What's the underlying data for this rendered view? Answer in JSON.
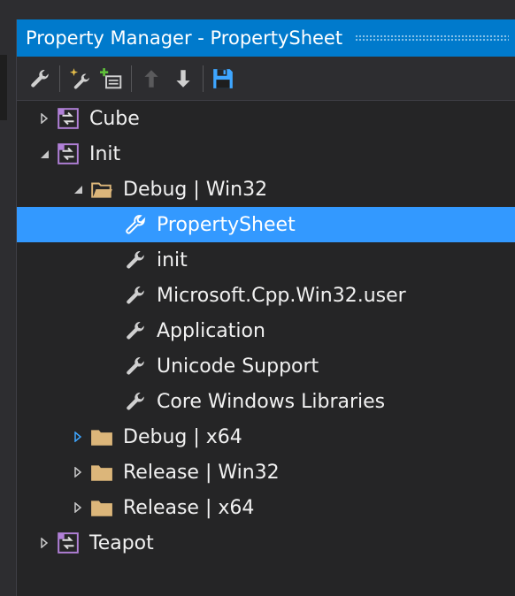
{
  "window": {
    "title": "Property Manager - PropertySheet"
  },
  "toolbar": {
    "buttons": [
      {
        "icon": "wrench-icon",
        "label": "Properties"
      },
      {
        "icon": "new-property-sheet-icon",
        "label": "Add New Project Property Sheet"
      },
      {
        "icon": "add-existing-sheet-icon",
        "label": "Add Existing Property Sheet"
      },
      {
        "icon": "arrow-up-icon",
        "label": "Move Up"
      },
      {
        "icon": "arrow-down-icon",
        "label": "Move Down"
      },
      {
        "icon": "save-icon",
        "label": "Save"
      }
    ]
  },
  "tree": [
    {
      "label": "Cube",
      "icon": "project-icon",
      "state": "collapsed",
      "level": 0
    },
    {
      "label": "Init",
      "icon": "project-icon",
      "state": "expanded",
      "level": 0
    },
    {
      "label": "Debug | Win32",
      "icon": "folder-open-icon",
      "state": "expanded",
      "level": 1
    },
    {
      "label": "PropertySheet",
      "icon": "property-sheet-icon",
      "state": "leaf",
      "level": 2,
      "selected": true
    },
    {
      "label": "init",
      "icon": "property-sheet-icon",
      "state": "leaf",
      "level": 2
    },
    {
      "label": "Microsoft.Cpp.Win32.user",
      "icon": "property-sheet-icon",
      "state": "leaf",
      "level": 2
    },
    {
      "label": "Application",
      "icon": "property-sheet-icon",
      "state": "leaf",
      "level": 2
    },
    {
      "label": "Unicode Support",
      "icon": "property-sheet-icon",
      "state": "leaf",
      "level": 2
    },
    {
      "label": "Core Windows Libraries",
      "icon": "property-sheet-icon",
      "state": "leaf",
      "level": 2
    },
    {
      "label": "Debug | x64",
      "icon": "folder-icon",
      "state": "collapsed-hover",
      "level": 1
    },
    {
      "label": "Release | Win32",
      "icon": "folder-icon",
      "state": "collapsed",
      "level": 1
    },
    {
      "label": "Release | x64",
      "icon": "folder-icon",
      "state": "collapsed",
      "level": 1
    },
    {
      "label": "Teapot",
      "icon": "project-icon",
      "state": "collapsed",
      "level": 0
    }
  ],
  "colors": {
    "accent": "#007acc",
    "selection": "#3399ff",
    "background": "#252526",
    "folder": "#dcb67a",
    "project_icon": "#b180d7",
    "hover_arrow": "#3ea6ff"
  }
}
